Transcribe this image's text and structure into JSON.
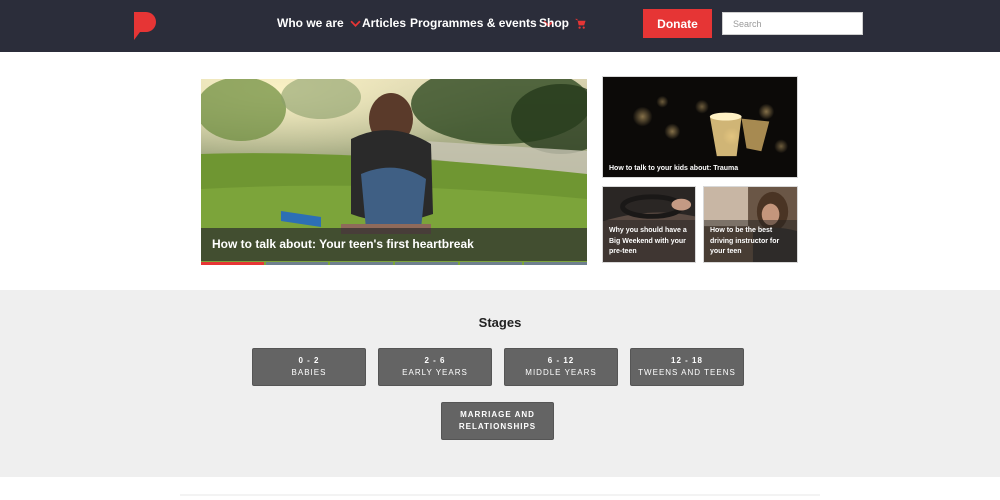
{
  "header": {
    "logo_icon": "brand-p-logo",
    "nav": [
      {
        "label": "Who we are",
        "has_dropdown": true
      },
      {
        "label": "Articles",
        "has_dropdown": false
      },
      {
        "label": "Programmes & events",
        "has_dropdown": true
      },
      {
        "label": "Shop",
        "icon": "cart-icon"
      }
    ],
    "donate_label": "Donate",
    "search_placeholder": "Search",
    "colors": {
      "bar": "#2b2d3a",
      "accent": "#e63535"
    }
  },
  "hero": {
    "title": "How to talk about: Your teen's first heartbreak",
    "slides": 6,
    "active_slide": 1
  },
  "featured": [
    {
      "title": "How to talk to your kids about: Trauma"
    },
    {
      "title": "Why you should have a Big Weekend with your pre-teen"
    },
    {
      "title": "How to be the best driving instructor for your teen"
    }
  ],
  "stages": {
    "title": "Stages",
    "items": [
      {
        "range": "0 - 2",
        "name": "BABIES"
      },
      {
        "range": "2 - 6",
        "name": "EARLY YEARS"
      },
      {
        "range": "6 - 12",
        "name": "MIDDLE YEARS"
      },
      {
        "range": "12 - 18",
        "name": "TWEENS AND TEENS"
      }
    ],
    "wide_item": {
      "line1": "MARRIAGE AND",
      "line2": "RELATIONSHIPS"
    }
  }
}
